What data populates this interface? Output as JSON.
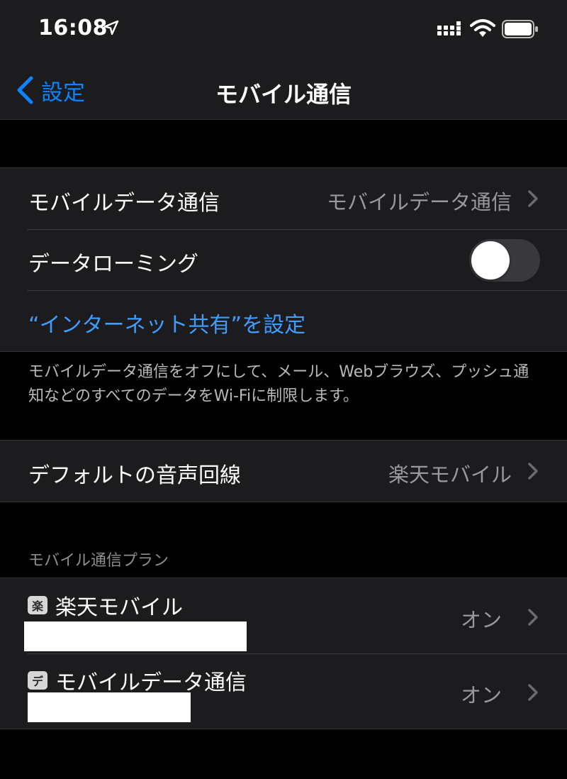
{
  "status_bar": {
    "time": "16:08",
    "location_icon": "location-arrow-icon",
    "signal_icon": "cellular-signal-icon",
    "wifi_icon": "wifi-icon",
    "battery_icon": "battery-icon"
  },
  "nav": {
    "back_label": "設定",
    "title": "モバイル通信"
  },
  "cellular_group": {
    "mobile_data_label": "モバイルデータ通信",
    "mobile_data_value": "モバイルデータ通信",
    "data_roaming_label": "データローミング",
    "data_roaming_on": false,
    "hotspot_link": "“インターネット共有”を設定"
  },
  "footer_note": "モバイルデータ通信をオフにして、メール、Webブラウズ、プッシュ通知などのすべてのデータをWi-Fiに制限します。",
  "voice_group": {
    "default_voice_label": "デフォルトの音声回線",
    "default_voice_value": "楽天モバイル"
  },
  "plans": {
    "header": "モバイル通信プラン",
    "items": [
      {
        "badge": "楽",
        "name": "楽天モバイル",
        "status": "オン"
      },
      {
        "badge": "デ",
        "name": "モバイルデータ通信",
        "status": "オン"
      }
    ]
  },
  "colors": {
    "accent": "#0a84ff",
    "background": "#000000",
    "cell_background": "#1c1c1e",
    "secondary_text": "#98989d"
  }
}
